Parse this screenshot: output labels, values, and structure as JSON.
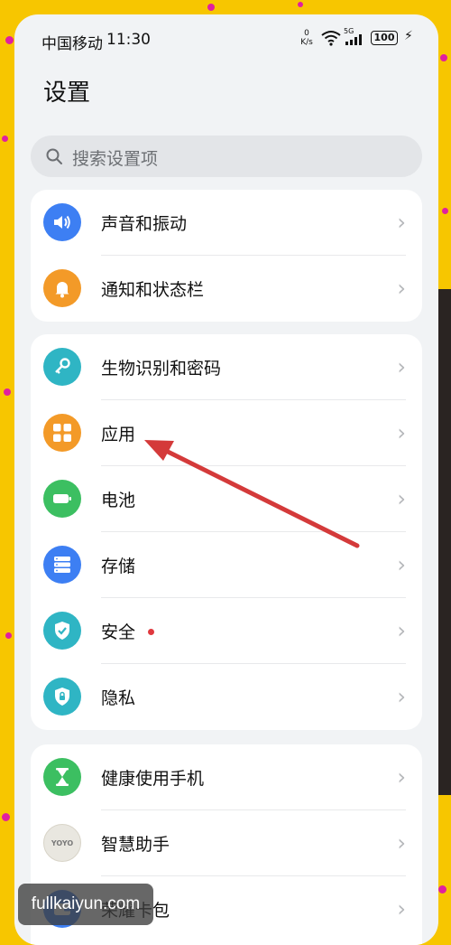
{
  "status_bar": {
    "carrier": "中国移动",
    "time": "11:30",
    "speed_value": "0",
    "speed_unit": "K/s",
    "network": "5G",
    "battery": "100"
  },
  "header": {
    "title": "设置"
  },
  "search": {
    "placeholder": "搜索设置项"
  },
  "groups": [
    {
      "items": [
        {
          "label": "声音和振动",
          "icon": "speaker-icon",
          "color": "#3d7ff3"
        },
        {
          "label": "通知和状态栏",
          "icon": "bell-icon",
          "color": "#f39a28"
        }
      ]
    },
    {
      "items": [
        {
          "label": "生物识别和密码",
          "icon": "key-icon",
          "color": "#2fb5c4"
        },
        {
          "label": "应用",
          "icon": "apps-grid-icon",
          "color": "#f39a28"
        },
        {
          "label": "电池",
          "icon": "battery-icon",
          "color": "#3cbf61"
        },
        {
          "label": "存储",
          "icon": "storage-icon",
          "color": "#3d7ff3"
        },
        {
          "label": "安全",
          "icon": "shield-check-icon",
          "color": "#2fb5c4",
          "badge": "red-dot"
        },
        {
          "label": "隐私",
          "icon": "lock-shield-icon",
          "color": "#2fb5c4"
        }
      ]
    },
    {
      "items": [
        {
          "label": "健康使用手机",
          "icon": "hourglass-icon",
          "color": "#3cbf61"
        },
        {
          "label": "智慧助手",
          "icon": "yoyo-icon",
          "icon_text": "YOYO",
          "color": "#e9e7e0"
        },
        {
          "label": "荣耀卡包",
          "icon": "wallet-icon",
          "color": "#3d7ff3"
        }
      ]
    }
  ],
  "watermark": "fullkaiyun.com",
  "annotation": {
    "type": "red-arrow",
    "points_to": "应用"
  },
  "colors": {
    "background": "#f7c600",
    "accent_dots": "#e01fa0",
    "arrow": "#d43a3a"
  }
}
